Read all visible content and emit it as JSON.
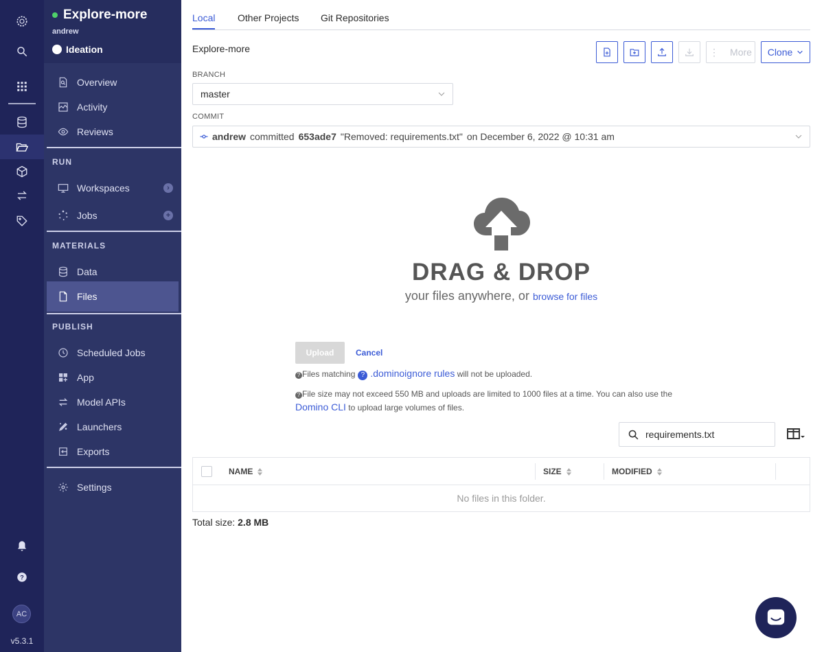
{
  "app": {
    "version": "v5.3.1",
    "avatar_initials": "AC"
  },
  "project": {
    "name": "Explore-more",
    "owner": "andrew",
    "stage": "Ideation"
  },
  "sidebar": {
    "top_items": [
      {
        "label": "Overview",
        "icon": "overview-icon"
      },
      {
        "label": "Activity",
        "icon": "activity-icon"
      },
      {
        "label": "Reviews",
        "icon": "eye-icon"
      }
    ],
    "run_label": "RUN",
    "run_items": [
      {
        "label": "Workspaces",
        "icon": "monitor-icon"
      },
      {
        "label": "Jobs",
        "icon": "spinner-icon"
      }
    ],
    "materials_label": "MATERIALS",
    "materials_items": [
      {
        "label": "Data",
        "icon": "database-icon"
      },
      {
        "label": "Files",
        "icon": "file-icon",
        "active": true
      }
    ],
    "publish_label": "PUBLISH",
    "publish_items": [
      {
        "label": "Scheduled Jobs",
        "icon": "clock-icon"
      },
      {
        "label": "App",
        "icon": "app-icon"
      },
      {
        "label": "Model APIs",
        "icon": "arrows-icon"
      },
      {
        "label": "Launchers",
        "icon": "launcher-icon"
      },
      {
        "label": "Exports",
        "icon": "export-icon"
      }
    ],
    "settings_label": "Settings"
  },
  "tabs": [
    "Local",
    "Other Projects",
    "Git Repositories"
  ],
  "active_tab": "Local",
  "path": "Explore-more",
  "toolbar": {
    "more_label": "More",
    "clone_label": "Clone"
  },
  "branch": {
    "label": "BRANCH",
    "value": "master"
  },
  "commit": {
    "label": "COMMIT",
    "author": "andrew",
    "verb": "committed",
    "hash": "653ade7",
    "message": "\"Removed: requirements.txt\"",
    "date": "on December 6, 2022 @ 10:31 am"
  },
  "dropzone": {
    "title": "DRAG & DROP",
    "subtitle": "your files anywhere, or",
    "browse_link": "browse for files",
    "upload_label": "Upload",
    "cancel_label": "Cancel",
    "note1_prefix": "Files matching",
    "note1_link": ".dominoignore rules",
    "note1_suffix": "will not be uploaded.",
    "note2_text": "File size may not exceed 550 MB and uploads are limited to 1000 files at a time. You can also use the",
    "note2_link": "Domino CLI",
    "note2_suffix": "to upload large volumes of files."
  },
  "search": {
    "value": "requirements.txt"
  },
  "table": {
    "columns": [
      "NAME",
      "SIZE",
      "MODIFIED"
    ],
    "empty_text": "No files in this folder."
  },
  "total": {
    "label": "Total size:",
    "value": "2.8 MB"
  },
  "colors": {
    "rail": "#1f2459",
    "sidebar": "#2d3566",
    "accent": "#3b5bd6"
  }
}
